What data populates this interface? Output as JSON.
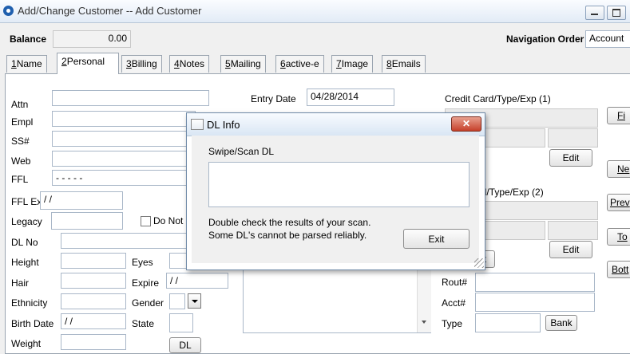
{
  "window": {
    "title": "Add/Change Customer -- Add Customer"
  },
  "header": {
    "balance_label": "Balance",
    "balance_value": "0.00",
    "nav_order_label": "Navigation Order",
    "nav_order_value": "Account"
  },
  "tabs": [
    {
      "key": "1",
      "label": "Name"
    },
    {
      "key": "2",
      "label": "Personal"
    },
    {
      "key": "3",
      "label": "Billing"
    },
    {
      "key": "4",
      "label": "Notes"
    },
    {
      "key": "5",
      "label": "Mailing"
    },
    {
      "key": "6",
      "label": "active-e"
    },
    {
      "key": "7",
      "label": "Image"
    },
    {
      "key": "8",
      "label": "Emails"
    }
  ],
  "personal": {
    "attn": {
      "label": "Attn",
      "value": ""
    },
    "empl": {
      "label": "Empl",
      "value": ""
    },
    "ssn": {
      "label": "SS#",
      "value": ""
    },
    "web": {
      "label": "Web",
      "value": ""
    },
    "ffl": {
      "label": "FFL",
      "value": "- - - - -"
    },
    "ffl_exp": {
      "label": "FFL Exp",
      "value": "/ /"
    },
    "legacy": {
      "label": "Legacy",
      "value": ""
    },
    "do_not_label": "Do Not",
    "dl_no": {
      "label": "DL No",
      "value": ""
    },
    "height": {
      "label": "Height",
      "value": ""
    },
    "eyes": {
      "label": "Eyes",
      "value": ""
    },
    "hair": {
      "label": "Hair",
      "value": ""
    },
    "expire": {
      "label": "Expire",
      "value": "/ /"
    },
    "ethnicity": {
      "label": "Ethnicity",
      "value": ""
    },
    "gender": {
      "label": "Gender",
      "value": ""
    },
    "birth_date": {
      "label": "Birth Date",
      "value": "/ /"
    },
    "state": {
      "label": "State",
      "value": ""
    },
    "weight": {
      "label": "Weight",
      "value": ""
    },
    "dl_button": "DL",
    "entry_date": {
      "label": "Entry Date",
      "value": "04/28/2014"
    }
  },
  "billing": {
    "cc1_label": "Credit Card/Type/Exp (1)",
    "cc2_label": "ard/Type/Exp (2)",
    "edit1": "Edit",
    "edit2": "Edit",
    "partial_button": "nt",
    "rout_label": "Rout#",
    "acct_label": "Acct#",
    "type_label": "Type",
    "bank_button": "Bank"
  },
  "side_buttons": [
    "Fi",
    "Ne",
    "Prev",
    "To",
    "Bott"
  ],
  "dialog": {
    "title": "DL Info",
    "close_glyph": "✕",
    "swipe_label": "Swipe/Scan DL",
    "swipe_value": "",
    "note_line1": "Double check the results of your scan.",
    "note_line2": "Some DL's cannot be parsed reliably.",
    "exit_button": "Exit"
  }
}
